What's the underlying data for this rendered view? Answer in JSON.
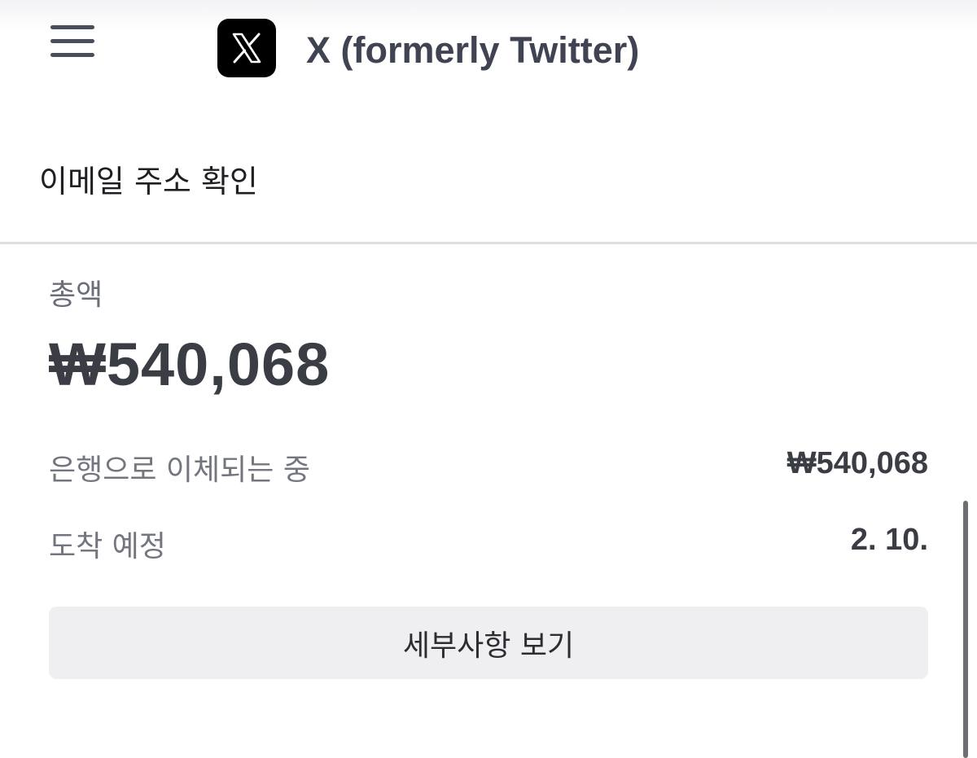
{
  "header": {
    "menu_icon": "hamburger-menu-icon",
    "app_logo_icon": "x-logo-icon",
    "app_title": "X (formerly Twitter)"
  },
  "account": {
    "verify_email_label": "이메일 주소 확인"
  },
  "payout": {
    "total_label": "총액",
    "total_amount": "₩540,068",
    "transfer_label": "은행으로 이체되는 중",
    "transfer_amount": "₩540,068",
    "arrival_label": "도착 예정",
    "arrival_date": "2. 10.",
    "details_button_label": "세부사항 보기"
  },
  "colors": {
    "logo_background": "#000000",
    "title_text": "#3f4352",
    "button_background": "#efeff2",
    "divider": "#dedee3"
  }
}
